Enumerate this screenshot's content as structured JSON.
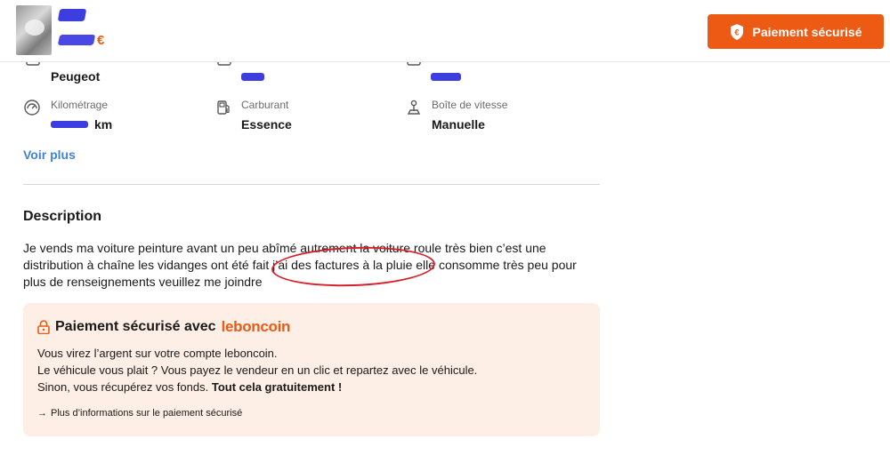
{
  "header": {
    "price_currency": "€",
    "pay_button_label": "Paiement sécurisé",
    "shield_icon_glyph": "€"
  },
  "criteria": [
    {
      "label": "",
      "value": "Peugeot",
      "icon": "car-brand-icon"
    },
    {
      "label": "",
      "value": "",
      "icon": "car-model-icon"
    },
    {
      "label": "",
      "value": "",
      "icon": "year-icon"
    },
    {
      "label": "Kilométrage",
      "value_suffix": "km",
      "icon": "speedometer-icon"
    },
    {
      "label": "Carburant",
      "value": "Essence",
      "icon": "fuel-pump-icon"
    },
    {
      "label": "Boîte de vitesse",
      "value": "Manuelle",
      "icon": "gear-shift-icon"
    }
  ],
  "voir_plus": "Voir plus",
  "description": {
    "title": "Description",
    "lines": [
      "Je vends ma voiture peinture avant un peu abîmé autrement la voiture roule très bien c’est une",
      "distribution à chaîne les vidanges ont été fait j’ai des factures à la pluie elle consomme très peu pour",
      "plus de renseignements veuillez me joindre"
    ]
  },
  "secure_payment": {
    "title": "Paiement sécurisé avec",
    "brand": "leboncoin",
    "line1": "Vous virez l’argent sur votre compte leboncoin.",
    "line2": "Le véhicule vous plait ? Vous payez le vendeur en un clic et repartez avec le véhicule.",
    "line3_start": "Sinon, vous récupérez vos fonds. ",
    "line3_bold": "Tout cela gratuitement !",
    "link_arrow": "→",
    "link_label": "Plus d’informations sur le paiement sécurisé"
  },
  "colors": {
    "accent": "#ec5a13",
    "link": "#4183d7",
    "redaction": "#3c3ee0",
    "annotation_circle": "#d6202a",
    "payment_box_bg": "#fdeee6"
  }
}
